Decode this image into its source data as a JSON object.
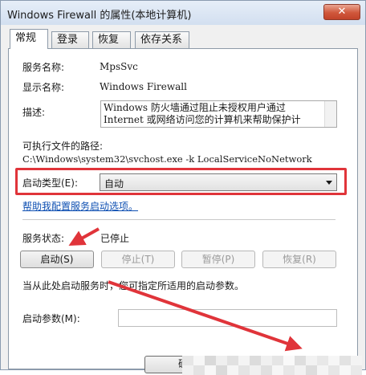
{
  "window": {
    "title": "Windows Firewall 的属性(本地计算机)",
    "close_glyph": "✕"
  },
  "tabs": [
    "常规",
    "登录",
    "恢复",
    "依存关系"
  ],
  "general": {
    "service_name_label": "服务名称:",
    "service_name_value": "MpsSvc",
    "display_name_label": "显示名称:",
    "display_name_value": "Windows Firewall",
    "description_label": "描述:",
    "description_text": "Windows 防火墙通过阻止未授权用户通过 Internet 或网络访问您的计算机来帮助保护计",
    "exe_path_label": "可执行文件的路径:",
    "exe_path_value": "C:\\Windows\\system32\\svchost.exe -k LocalServiceNoNetwork",
    "startup_type_label": "启动类型(E):",
    "startup_type_value": "自动",
    "help_link": "帮助我配置服务启动选项。",
    "service_status_label": "服务状态:",
    "service_status_value": "已停止",
    "buttons": {
      "start": "启动(S)",
      "stop": "停止(T)",
      "pause": "暂停(P)",
      "resume": "恢复(R)"
    },
    "hint": "当从此处启动服务时，您可指定所适用的启动参数。",
    "start_params_label": "启动参数(M):",
    "start_params_value": ""
  },
  "footer": {
    "ok_label": "确"
  },
  "colors": {
    "highlight": "#e0343a",
    "link": "#0e4fb2",
    "close_button": "#c9472d"
  }
}
